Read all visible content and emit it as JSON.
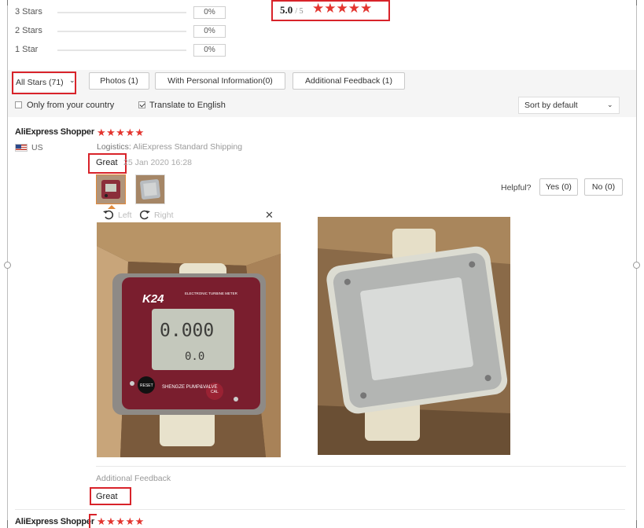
{
  "rating_breakdown": [
    {
      "label": "3 Stars",
      "percent": "0%",
      "fraction": 0
    },
    {
      "label": "2 Stars",
      "percent": "0%",
      "fraction": 0
    },
    {
      "label": "1 Star",
      "percent": "0%",
      "fraction": 0
    }
  ],
  "overall": {
    "score": "5.0",
    "out_of": "/ 5",
    "stars": 5
  },
  "filters": {
    "stars_select": "All Stars (71)",
    "photos_button": "Photos (1)",
    "personal_info_button": "With Personal Information(0)",
    "additional_feedback_button": "Additional Feedback (1)",
    "only_country_label": "Only from your country",
    "only_country_checked": false,
    "translate_label": "Translate to English",
    "translate_checked": true,
    "sort_value": "Sort by default"
  },
  "reviews": [
    {
      "user": "AliExpress Shopper",
      "stars": 5,
      "country": "US",
      "logistics_label": "Logistics:",
      "logistics_value": "AliExpress Standard Shipping",
      "text": "Great",
      "date": "25 Jan 2020 16:28",
      "helpful_label": "Helpful?",
      "yes_button": "Yes (0)",
      "no_button": "No (0)",
      "viewer": {
        "left_label": "Left",
        "right_label": "Right"
      },
      "photo_meter": {
        "brand": "K24",
        "title": "ELECTRONIC TURBINE METER",
        "reading_main": "0.000",
        "reading_sub": "0.0",
        "reset_label": "RESET",
        "cal_label": "CAL",
        "maker": "SHENGZE PUMP&VALVE"
      },
      "additional_feedback_label": "Additional Feedback",
      "additional_feedback_text": "Great"
    },
    {
      "user": "AliExpress Shopper",
      "stars": 5
    }
  ],
  "colors": {
    "star_red": "#e3352f",
    "highlight_red": "#d8232a"
  }
}
